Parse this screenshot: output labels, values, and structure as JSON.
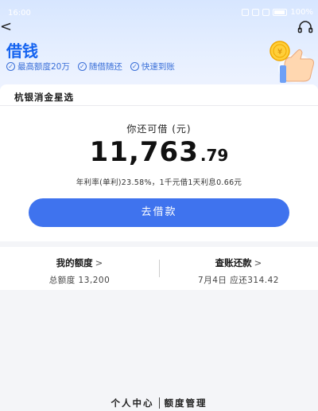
{
  "status": {
    "time": "16:00",
    "battery": "100%"
  },
  "header": {
    "title": "借钱",
    "features": [
      "最高额度20万",
      "随借随还",
      "快速到账"
    ]
  },
  "product": {
    "name": "杭银消金星选"
  },
  "main": {
    "available_label": "你还可借 (元)",
    "amount_integer": "11,763",
    "amount_decimal": ".79",
    "rate_text": "年利率(单利)23.58%，1千元借1天利息0.66元",
    "borrow_button": "去借款"
  },
  "links": {
    "quota_title": "我的额度",
    "quota_sub": "总额度 13,200",
    "bill_title": "查账还款",
    "bill_sub": "7月4日 应还314.42"
  },
  "bottom_nav": {
    "personal": "个人中心",
    "quota_manage": "额度管理"
  }
}
